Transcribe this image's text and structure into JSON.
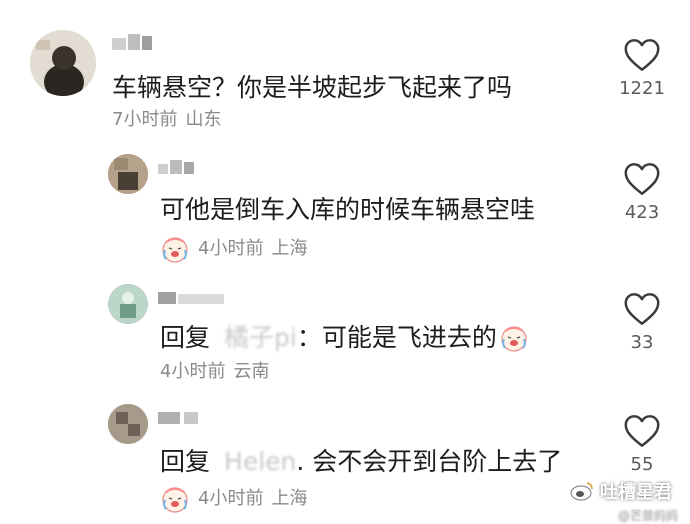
{
  "comments": [
    {
      "username": "",
      "text": "车辆悬空？你是半坡起步飞起来了吗",
      "time": "7小时前",
      "location": "山东",
      "likes": "1221",
      "avatar_color": "#d8cfc4"
    },
    {
      "username": "",
      "text": "可他是倒车入库的时候车辆悬空哇",
      "time": "4小时前",
      "location": "上海",
      "likes": "423",
      "avatar_color": "#8a7a66"
    },
    {
      "username": "",
      "reply_prefix": "回复",
      "reply_to": "橘子pi",
      "text": "：可能是飞进去的",
      "time": "4小时前",
      "location": "云南",
      "likes": "33",
      "avatar_color": "#a9c6b8"
    },
    {
      "username": "",
      "reply_prefix": "回复",
      "reply_to": "Helen",
      "text": ". 会不会开到台阶上去了",
      "time": "4小时前",
      "location": "上海",
      "likes": "55",
      "avatar_color": "#9a8d80"
    }
  ],
  "watermark": {
    "brand": "吐槽星君",
    "sub": "@芒果妈妈"
  },
  "colors": {
    "heart_outline": "#3a3a3a",
    "meta_text": "#8a8a8a"
  },
  "icons": {
    "like": "heart-outline-icon",
    "emoji": "crying-laughing-face-icon"
  }
}
